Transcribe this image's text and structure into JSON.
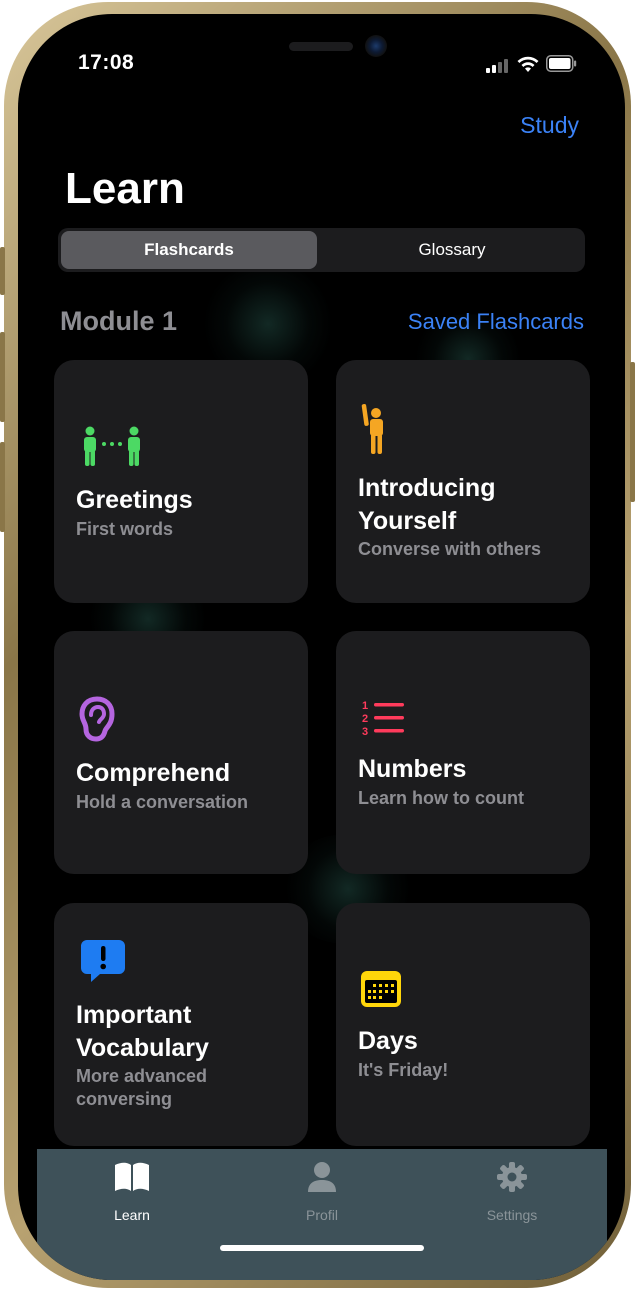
{
  "status_bar": {
    "time": "17:08"
  },
  "header": {
    "study_button": "Study",
    "title": "Learn"
  },
  "segmented_control": {
    "options": [
      "Flashcards",
      "Glossary"
    ],
    "selected": "Flashcards"
  },
  "module": {
    "title": "Module 1",
    "saved_link": "Saved Flashcards"
  },
  "cards": [
    {
      "title": "Greetings",
      "subtitle": "First words",
      "icon": "greeting-people-icon",
      "color": "#4cd964"
    },
    {
      "title": "Introducing Yourself",
      "subtitle": "Converse with others",
      "icon": "raised-hand-person-icon",
      "color": "#f5a623"
    },
    {
      "title": "Comprehend",
      "subtitle": "Hold a conversation",
      "icon": "ear-icon",
      "color": "#b565e0"
    },
    {
      "title": "Numbers",
      "subtitle": "Learn how to count",
      "icon": "numbered-list-icon",
      "color": "#ff3b5c"
    },
    {
      "title": "Important Vocabulary",
      "subtitle": "More advanced conversing",
      "icon": "exclamation-bubble-icon",
      "color": "#1e7cf2"
    },
    {
      "title": "Days",
      "subtitle": "It's Friday!",
      "icon": "calendar-icon",
      "color": "#ffd60a"
    }
  ],
  "tab_bar": {
    "tabs": [
      {
        "label": "Learn",
        "icon": "book-icon",
        "active": true
      },
      {
        "label": "Profil",
        "icon": "person-icon",
        "active": false
      },
      {
        "label": "Settings",
        "icon": "gear-icon",
        "active": false
      }
    ]
  },
  "colors": {
    "accent": "#3b82f6",
    "card": "#1c1c1e",
    "tab_bar": "#3e5159"
  }
}
